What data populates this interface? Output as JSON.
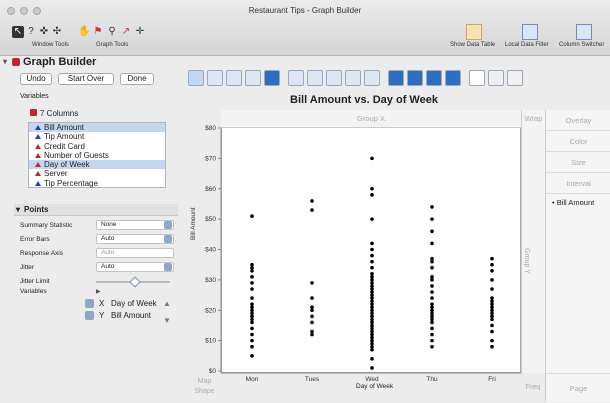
{
  "window": {
    "title": "Restaurant Tips - Graph Builder"
  },
  "toolbar": {
    "window_tools_label": "Window Tools",
    "graph_tools_label": "Graph Tools",
    "show_data_table": "Show Data Table",
    "local_data_filter": "Local Data Filter",
    "column_switcher": "Column Switcher"
  },
  "panel": {
    "title": "Graph Builder",
    "undo": "Undo",
    "start_over": "Start Over",
    "done": "Done",
    "variables_label": "Variables",
    "columns_header": "7 Columns",
    "columns": [
      {
        "name": "Bill Amount",
        "type": "continuous",
        "selected": true
      },
      {
        "name": "Tip Amount",
        "type": "continuous",
        "selected": false
      },
      {
        "name": "Credit Card",
        "type": "nominal",
        "selected": false
      },
      {
        "name": "Number of Guests",
        "type": "nominal",
        "selected": false
      },
      {
        "name": "Day of Week",
        "type": "nominal",
        "selected": true
      },
      {
        "name": "Server",
        "type": "nominal",
        "selected": false
      },
      {
        "name": "Tip Percentage",
        "type": "continuous",
        "selected": false
      }
    ]
  },
  "points": {
    "header": "Points",
    "summary_statistic_label": "Summary Statistic",
    "summary_statistic": "None",
    "error_bars_label": "Error Bars",
    "error_bars": "Auto",
    "response_axis_label": "Response Axis",
    "response_axis": "Auto",
    "jitter_label": "Jitter",
    "jitter": "Auto",
    "jitter_limit_label": "Jitter Limit",
    "jitter_limit": 0.5,
    "variables_label": "Variables",
    "x_role": "X",
    "x_var": "Day of Week",
    "y_role": "Y",
    "y_var": "Bill Amount"
  },
  "zones": {
    "group_x": "Group X",
    "group_y": "Group Y",
    "wrap": "Wrap",
    "overlay": "Overlay",
    "color": "Color",
    "size": "Size",
    "interval": "Interval",
    "map_shape_1": "Map",
    "map_shape_2": "Shape",
    "freq": "Freq",
    "page": "Page"
  },
  "legend": {
    "item": "Bill Amount"
  },
  "chart_data": {
    "type": "scatter",
    "title": "Bill Amount vs. Day of Week",
    "xlabel": "Day of Week",
    "ylabel": "Bill Amount",
    "categories": [
      "Mon",
      "Tues",
      "Wed",
      "Thu",
      "Fri"
    ],
    "ylim": [
      0,
      80
    ],
    "yticks": [
      "$0",
      "$10",
      "$20",
      "$30",
      "$40",
      "$50",
      "$60",
      "$70",
      "$80"
    ],
    "series": [
      {
        "name": "Bill Amount",
        "points": [
          {
            "x": "Mon",
            "values": [
              5,
              8,
              10,
              12,
              14,
              16,
              17,
              18,
              19,
              20,
              21,
              22,
              24,
              27,
              29,
              31,
              33,
              34,
              35,
              51
            ]
          },
          {
            "x": "Tues",
            "values": [
              12,
              13,
              16,
              18,
              20,
              21,
              24,
              29,
              53,
              56
            ]
          },
          {
            "x": "Wed",
            "values": [
              1,
              4,
              7,
              8,
              9,
              10,
              11,
              12,
              13,
              14,
              15,
              16,
              17,
              18,
              19,
              20,
              21,
              22,
              23,
              24,
              25,
              26,
              27,
              28,
              29,
              30,
              31,
              32,
              34,
              36,
              38,
              40,
              42,
              50,
              58,
              60,
              70
            ]
          },
          {
            "x": "Thu",
            "values": [
              8,
              10,
              12,
              14,
              16,
              17,
              18,
              19,
              20,
              21,
              22,
              24,
              26,
              28,
              30,
              31,
              34,
              36,
              37,
              42,
              46,
              50,
              54
            ]
          },
          {
            "x": "Fri",
            "values": [
              8,
              10,
              13,
              15,
              17,
              18,
              19,
              20,
              21,
              22,
              23,
              24,
              27,
              30,
              33,
              35,
              37
            ]
          }
        ]
      }
    ],
    "grid": false,
    "legend_position": "right"
  }
}
